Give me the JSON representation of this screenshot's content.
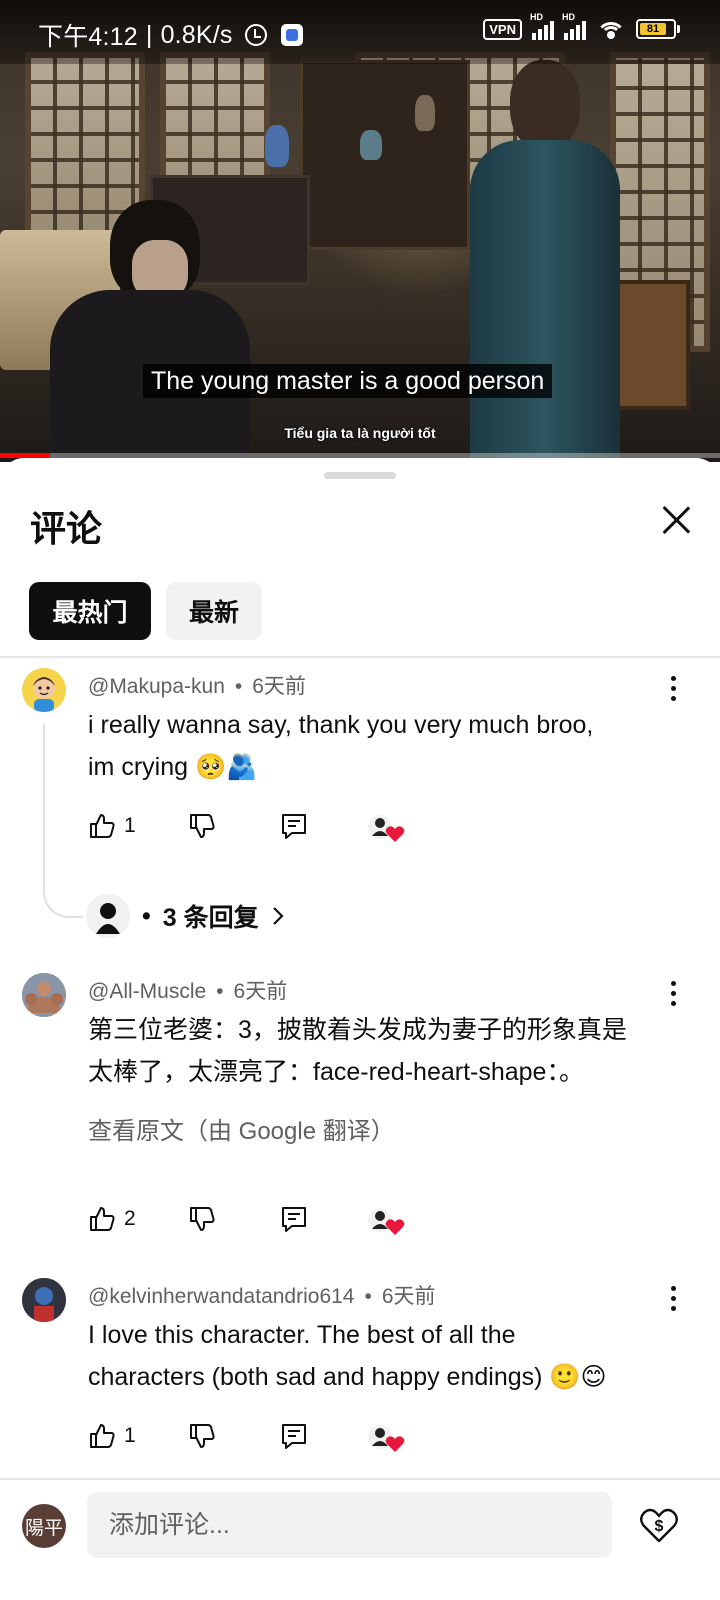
{
  "status_bar": {
    "time": "下午4:12",
    "separator": "|",
    "net_speed": "0.8K/s",
    "vpn": "VPN",
    "hd1": "HD",
    "hd2": "HD",
    "battery": "81"
  },
  "video": {
    "subtitle_en": "The young master is a good person",
    "subtitle_vi": "Tiểu gia ta là người tốt",
    "progress_percent": 7
  },
  "sheet": {
    "title": "评论",
    "tabs": [
      {
        "label": "最热门",
        "selected": true
      },
      {
        "label": "最新",
        "selected": false
      }
    ]
  },
  "comments": [
    {
      "author": "@Makupa-kun",
      "time": "6天前",
      "text_line1": "i really wanna say, thank you very much broo,",
      "text_line2": "im crying 🥺🫂",
      "likes": "1",
      "replies": "3 条回复"
    },
    {
      "author": "@All-Muscle",
      "time": "6天前",
      "text_line1": "第三位老婆：3，披散着头发成为妻子的形象真是",
      "text_line2": "太棒了，太漂亮了：face-red-heart-shape：。",
      "translate": "查看原文（由 Google 翻译）",
      "likes": "2"
    },
    {
      "author": "@kelvinherwandatandrio614",
      "time": "6天前",
      "text_line1": "I love this character. The best of all the",
      "text_line2": "characters (both sad and happy endings) 🙂😊",
      "likes": "1"
    }
  ],
  "input": {
    "avatar_text": "陽平",
    "placeholder": "添加评论..."
  },
  "colors": {
    "accent_red": "#ff0000",
    "heart": "#e8173c",
    "chip_selected_bg": "#0f0f0f",
    "chip_bg": "#f2f2f2",
    "meta_text": "#606060"
  },
  "icons": [
    "alarm-icon",
    "signal-icon",
    "wifi-icon",
    "battery-icon",
    "close-icon",
    "thumbs-up-icon",
    "thumbs-down-icon",
    "reply-icon",
    "creator-heart-icon",
    "chevron-right-icon",
    "more-vert-icon",
    "thanks-heart-dollar-icon"
  ]
}
